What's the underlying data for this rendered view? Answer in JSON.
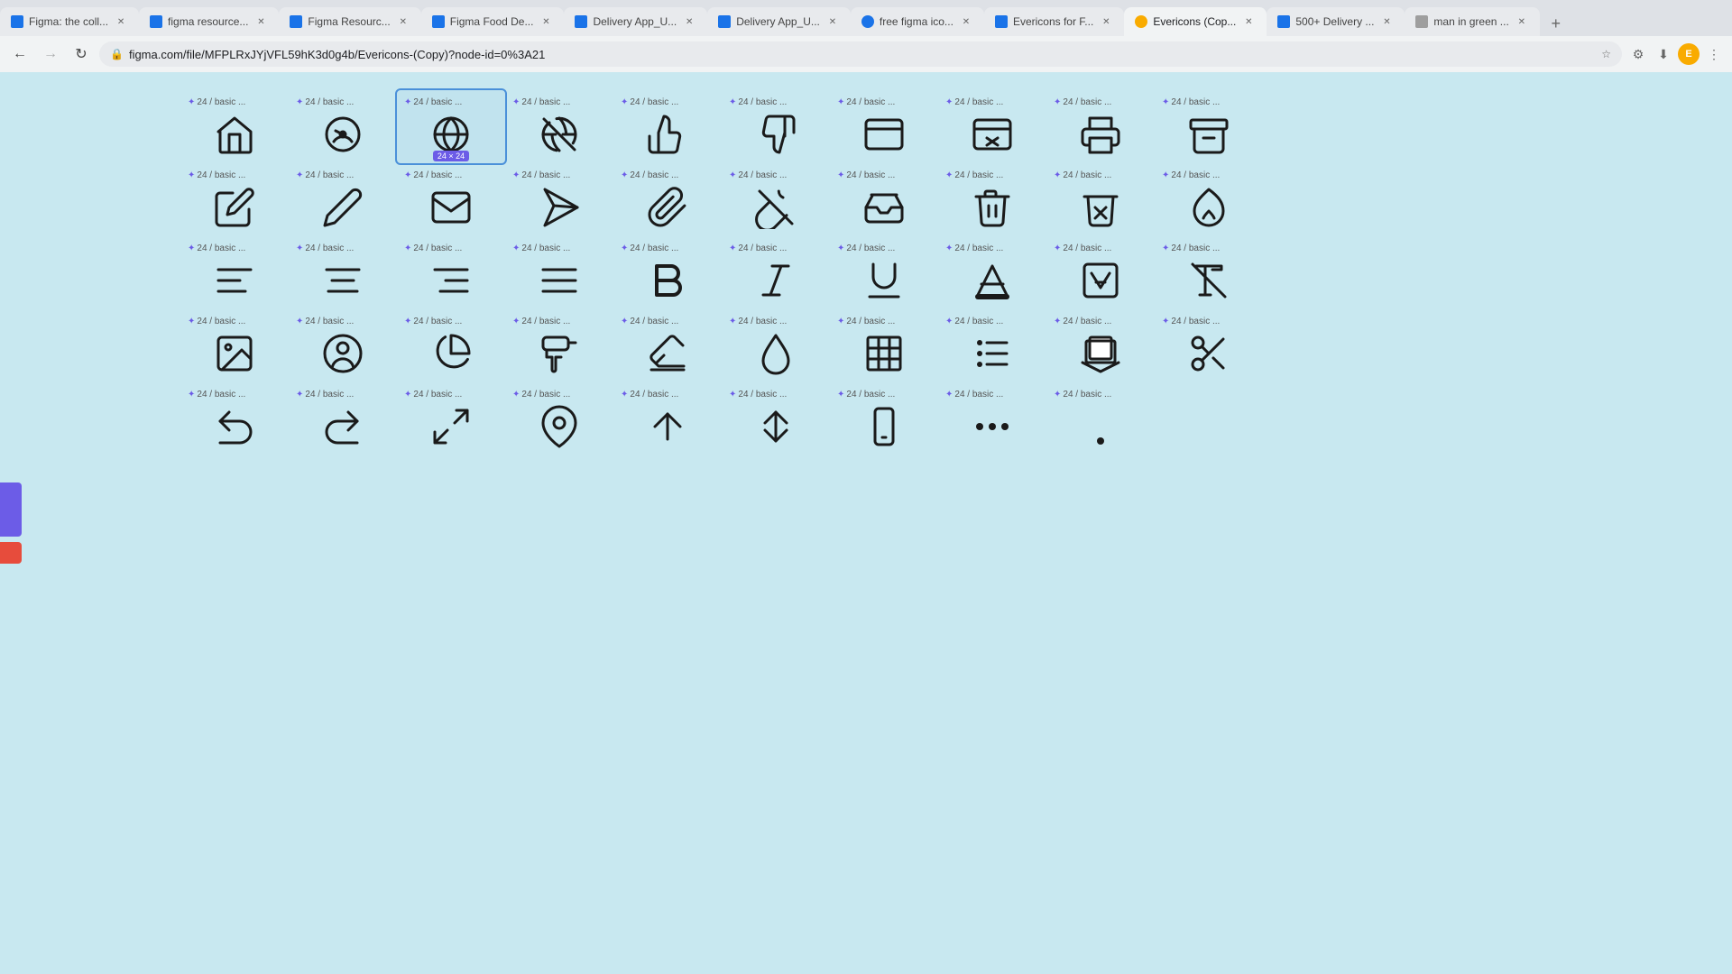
{
  "browser": {
    "tabs": [
      {
        "id": "t1",
        "label": "Figma: the coll...",
        "favicon": "fav-blue",
        "active": false
      },
      {
        "id": "t2",
        "label": "figma resource...",
        "favicon": "fav-blue",
        "active": false
      },
      {
        "id": "t3",
        "label": "Figma Resourc...",
        "favicon": "fav-blue",
        "active": false
      },
      {
        "id": "t4",
        "label": "Figma Food De...",
        "favicon": "fav-blue",
        "active": false
      },
      {
        "id": "t5",
        "label": "Delivery App_U...",
        "favicon": "fav-blue",
        "active": false
      },
      {
        "id": "t6",
        "label": "Delivery App_U...",
        "favicon": "fav-blue",
        "active": false
      },
      {
        "id": "t7",
        "label": "free figma ico...",
        "favicon": "fav-teal",
        "active": false
      },
      {
        "id": "t8",
        "label": "Evericons for F...",
        "favicon": "fav-blue",
        "active": false
      },
      {
        "id": "t9",
        "label": "Evericons (Cop...",
        "favicon": "fav-gold",
        "active": true
      },
      {
        "id": "t10",
        "label": "500+ Delivery ...",
        "favicon": "fav-blue",
        "active": false
      },
      {
        "id": "t11",
        "label": "man in green ...",
        "favicon": "fav-gray",
        "active": false
      }
    ],
    "address": "figma.com/file/MFPLRxJYjVFL59hK3d0g4b/Evericons-(Copy)?node-id=0%3A21",
    "back_label": "←",
    "forward_label": "→",
    "refresh_label": "↻"
  },
  "canvas": {
    "background_color": "#c8e8f0"
  },
  "icon_label_prefix": "24 / basic ...",
  "icon_label_prefix_star": "✦",
  "selected_badge": "24 × 24",
  "rows": [
    {
      "row_id": "row1",
      "icons": [
        {
          "id": "r1i1",
          "label": "24 / basic ...",
          "symbol": "home",
          "selected": false
        },
        {
          "id": "r1i2",
          "label": "24 / basic ...",
          "symbol": "speedometer",
          "selected": false
        },
        {
          "id": "r1i3",
          "label": "24 / basic ...",
          "symbol": "globe",
          "selected": true
        },
        {
          "id": "r1i4",
          "label": "24 / basic ...",
          "symbol": "globe-off",
          "selected": false
        },
        {
          "id": "r1i5",
          "label": "24 / basic ...",
          "symbol": "thumbs-up",
          "selected": false
        },
        {
          "id": "r1i6",
          "label": "24 / basic ...",
          "symbol": "thumbs-down",
          "selected": false
        },
        {
          "id": "r1i7",
          "label": "24 / basic ...",
          "symbol": "browser",
          "selected": false
        },
        {
          "id": "r1i8",
          "label": "24 / basic ...",
          "symbol": "browser-x",
          "selected": false
        },
        {
          "id": "r1i9",
          "label": "24 / basic ...",
          "symbol": "printer",
          "selected": false
        },
        {
          "id": "r1i10",
          "label": "24 / basic ...",
          "symbol": "archive",
          "selected": false
        }
      ]
    },
    {
      "row_id": "row2",
      "icons": [
        {
          "id": "r2i1",
          "label": "24 / basic ...",
          "symbol": "pencil",
          "selected": false
        },
        {
          "id": "r2i2",
          "label": "24 / basic ...",
          "symbol": "edit",
          "selected": false
        },
        {
          "id": "r2i3",
          "label": "24 / basic ...",
          "symbol": "mail",
          "selected": false
        },
        {
          "id": "r2i4",
          "label": "24 / basic ...",
          "symbol": "send",
          "selected": false
        },
        {
          "id": "r2i5",
          "label": "24 / basic ...",
          "symbol": "paperclip",
          "selected": false
        },
        {
          "id": "r2i6",
          "label": "24 / basic ...",
          "symbol": "paperclip-off",
          "selected": false
        },
        {
          "id": "r2i7",
          "label": "24 / basic ...",
          "symbol": "inbox",
          "selected": false
        },
        {
          "id": "r2i8",
          "label": "24 / basic ...",
          "symbol": "trash",
          "selected": false
        },
        {
          "id": "r2i9",
          "label": "24 / basic ...",
          "symbol": "trash-x",
          "selected": false
        },
        {
          "id": "r2i10",
          "label": "24 / basic ...",
          "symbol": "fire",
          "selected": false
        }
      ]
    },
    {
      "row_id": "row3",
      "icons": [
        {
          "id": "r3i1",
          "label": "24 / basic ...",
          "symbol": "align-left",
          "selected": false
        },
        {
          "id": "r3i2",
          "label": "24 / basic ...",
          "symbol": "align-center",
          "selected": false
        },
        {
          "id": "r3i3",
          "label": "24 / basic ...",
          "symbol": "align-right",
          "selected": false
        },
        {
          "id": "r3i4",
          "label": "24 / basic ...",
          "symbol": "align-justify",
          "selected": false
        },
        {
          "id": "r3i5",
          "label": "24 / basic ...",
          "symbol": "bold",
          "selected": false
        },
        {
          "id": "r3i6",
          "label": "24 / basic ...",
          "symbol": "italic",
          "selected": false
        },
        {
          "id": "r3i7",
          "label": "24 / basic ...",
          "symbol": "underline",
          "selected": false
        },
        {
          "id": "r3i8",
          "label": "24 / basic ...",
          "symbol": "text-color",
          "selected": false
        },
        {
          "id": "r3i9",
          "label": "24 / basic ...",
          "symbol": "text-box",
          "selected": false
        },
        {
          "id": "r3i10",
          "label": "24 / basic ...",
          "symbol": "text-off",
          "selected": false
        }
      ]
    },
    {
      "row_id": "row4",
      "icons": [
        {
          "id": "r4i1",
          "label": "24 / basic ...",
          "symbol": "image",
          "selected": false
        },
        {
          "id": "r4i2",
          "label": "24 / basic ...",
          "symbol": "user-circle",
          "selected": false
        },
        {
          "id": "r4i3",
          "label": "24 / basic ...",
          "symbol": "pie-chart",
          "selected": false
        },
        {
          "id": "r4i4",
          "label": "24 / basic ...",
          "symbol": "paint-roller",
          "selected": false
        },
        {
          "id": "r4i5",
          "label": "24 / basic ...",
          "symbol": "eraser",
          "selected": false
        },
        {
          "id": "r4i6",
          "label": "24 / basic ...",
          "symbol": "drop",
          "selected": false
        },
        {
          "id": "r4i7",
          "label": "24 / basic ...",
          "symbol": "table",
          "selected": false
        },
        {
          "id": "r4i8",
          "label": "24 / basic ...",
          "symbol": "list",
          "selected": false
        },
        {
          "id": "r4i9",
          "label": "24 / basic ...",
          "symbol": "layers",
          "selected": false
        },
        {
          "id": "r4i10",
          "label": "24 / basic ...",
          "symbol": "scissors",
          "selected": false
        }
      ]
    },
    {
      "row_id": "row5",
      "icons": [
        {
          "id": "r5i1",
          "label": "24 / basic ...",
          "symbol": "arrow-undo",
          "selected": false
        },
        {
          "id": "r5i2",
          "label": "24 / basic ...",
          "symbol": "arrow-redo",
          "selected": false
        },
        {
          "id": "r5i3",
          "label": "24 / basic ...",
          "symbol": "arrow-expand",
          "selected": false
        },
        {
          "id": "r5i4",
          "label": "24 / basic ...",
          "symbol": "location-pin",
          "selected": false
        },
        {
          "id": "r5i5",
          "label": "24 / basic ...",
          "symbol": "arrow-up",
          "selected": false
        },
        {
          "id": "r5i6",
          "label": "24 / basic ...",
          "symbol": "arrow-vert",
          "selected": false
        },
        {
          "id": "r5i7",
          "label": "24 / basic ...",
          "symbol": "phone",
          "selected": false
        },
        {
          "id": "r5i8",
          "label": "24 / basic ...",
          "symbol": "dots",
          "selected": false
        },
        {
          "id": "r5i9",
          "label": "24 / basic ...",
          "symbol": "dot",
          "selected": false
        }
      ]
    }
  ]
}
